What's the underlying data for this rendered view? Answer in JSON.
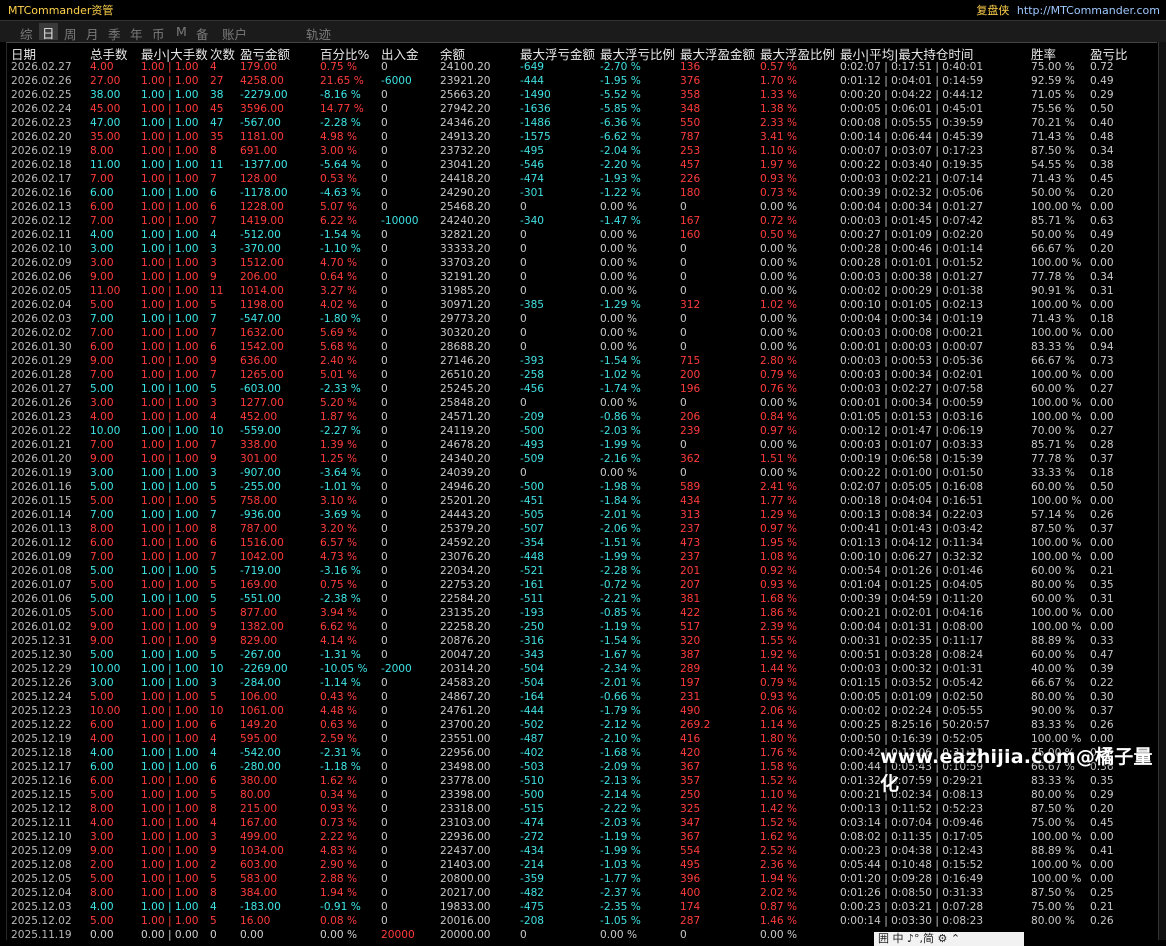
{
  "app": {
    "title": "MTCommander资管",
    "right_cn": "复盘侠",
    "right_url": "http://MTCommander.com"
  },
  "tabs": [
    {
      "label": "综",
      "active": false
    },
    {
      "label": "日",
      "active": true
    },
    {
      "label": "周",
      "active": false
    },
    {
      "label": "月",
      "active": false
    },
    {
      "label": "季",
      "active": false
    },
    {
      "label": "年",
      "active": false
    },
    {
      "label": "币",
      "active": false
    },
    {
      "label": "M",
      "active": false
    },
    {
      "label": "备",
      "active": false
    },
    {
      "label": "账户",
      "active": false
    },
    {
      "label": "轨迹",
      "active": false
    }
  ],
  "headers": [
    "日期",
    "总手数",
    "最小|大手数",
    "次数",
    "盈亏金额",
    "百分比%",
    "出入金",
    "余额",
    "最大浮亏金额",
    "最大浮亏比例",
    "最大浮盈金额",
    "最大浮盈比例",
    "最小|平均|最大持仓时间",
    "胜率",
    "盈亏比"
  ],
  "rows": [
    [
      "2026.02.27",
      "4.00",
      "1.00 | 1.00",
      "4",
      "179.00",
      "0.75 %",
      "0",
      "24100.20",
      "-649",
      "-2.70 %",
      "136",
      "0.57 %",
      "0:02:07 | 0:17:51 | 0:40:01",
      "75.00 %",
      "0.72"
    ],
    [
      "2026.02.26",
      "27.00",
      "1.00 | 1.00",
      "27",
      "4258.00",
      "21.65 %",
      "-6000",
      "23921.20",
      "-444",
      "-1.95 %",
      "376",
      "1.70 %",
      "0:01:12 | 0:04:01 | 0:14:59",
      "92.59 %",
      "0.49"
    ],
    [
      "2026.02.25",
      "38.00",
      "1.00 | 1.00",
      "38",
      "-2279.00",
      "-8.16 %",
      "0",
      "25663.20",
      "-1490",
      "-5.52 %",
      "358",
      "1.33 %",
      "0:00:20 | 0:04:22 | 0:44:12",
      "71.05 %",
      "0.29"
    ],
    [
      "2026.02.24",
      "45.00",
      "1.00 | 1.00",
      "45",
      "3596.00",
      "14.77 %",
      "0",
      "27942.20",
      "-1636",
      "-5.85 %",
      "348",
      "1.38 %",
      "0:00:05 | 0:06:01 | 0:45:01",
      "75.56 %",
      "0.50"
    ],
    [
      "2026.02.23",
      "47.00",
      "1.00 | 1.00",
      "47",
      "-567.00",
      "-2.28 %",
      "0",
      "24346.20",
      "-1486",
      "-6.36 %",
      "550",
      "2.33 %",
      "0:00:08 | 0:05:55 | 0:39:59",
      "70.21 %",
      "0.40"
    ],
    [
      "2026.02.20",
      "35.00",
      "1.00 | 1.00",
      "35",
      "1181.00",
      "4.98 %",
      "0",
      "24913.20",
      "-1575",
      "-6.62 %",
      "787",
      "3.41 %",
      "0:00:14 | 0:06:44 | 0:45:39",
      "71.43 %",
      "0.48"
    ],
    [
      "2026.02.19",
      "8.00",
      "1.00 | 1.00",
      "8",
      "691.00",
      "3.00 %",
      "0",
      "23732.20",
      "-495",
      "-2.04 %",
      "253",
      "1.10 %",
      "0:00:07 | 0:03:07 | 0:17:23",
      "87.50 %",
      "0.34"
    ],
    [
      "2026.02.18",
      "11.00",
      "1.00 | 1.00",
      "11",
      "-1377.00",
      "-5.64 %",
      "0",
      "23041.20",
      "-546",
      "-2.20 %",
      "457",
      "1.97 %",
      "0:00:22 | 0:03:40 | 0:19:35",
      "54.55 %",
      "0.38"
    ],
    [
      "2026.02.17",
      "7.00",
      "1.00 | 1.00",
      "7",
      "128.00",
      "0.53 %",
      "0",
      "24418.20",
      "-474",
      "-1.93 %",
      "226",
      "0.93 %",
      "0:00:03 | 0:02:21 | 0:07:14",
      "71.43 %",
      "0.45"
    ],
    [
      "2026.02.16",
      "6.00",
      "1.00 | 1.00",
      "6",
      "-1178.00",
      "-4.63 %",
      "0",
      "24290.20",
      "-301",
      "-1.22 %",
      "180",
      "0.73 %",
      "0:00:39 | 0:02:32 | 0:05:06",
      "50.00 %",
      "0.20"
    ],
    [
      "2026.02.13",
      "6.00",
      "1.00 | 1.00",
      "6",
      "1228.00",
      "5.07 %",
      "0",
      "25468.20",
      "0",
      "0.00 %",
      "0",
      "0.00 %",
      "0:00:04 | 0:00:34 | 0:01:27",
      "100.00 %",
      "0.00"
    ],
    [
      "2026.02.12",
      "7.00",
      "1.00 | 1.00",
      "7",
      "1419.00",
      "6.22 %",
      "-10000",
      "24240.20",
      "-340",
      "-1.47 %",
      "167",
      "0.72 %",
      "0:00:03 | 0:01:45 | 0:07:42",
      "85.71 %",
      "0.63"
    ],
    [
      "2026.02.11",
      "4.00",
      "1.00 | 1.00",
      "4",
      "-512.00",
      "-1.54 %",
      "0",
      "32821.20",
      "0",
      "0.00 %",
      "160",
      "0.50 %",
      "0:00:27 | 0:01:09 | 0:02:20",
      "50.00 %",
      "0.49"
    ],
    [
      "2026.02.10",
      "3.00",
      "1.00 | 1.00",
      "3",
      "-370.00",
      "-1.10 %",
      "0",
      "33333.20",
      "0",
      "0.00 %",
      "0",
      "0.00 %",
      "0:00:28 | 0:00:46 | 0:01:14",
      "66.67 %",
      "0.20"
    ],
    [
      "2026.02.09",
      "3.00",
      "1.00 | 1.00",
      "3",
      "1512.00",
      "4.70 %",
      "0",
      "33703.20",
      "0",
      "0.00 %",
      "0",
      "0.00 %",
      "0:00:28 | 0:01:01 | 0:01:52",
      "100.00 %",
      "0.00"
    ],
    [
      "2026.02.06",
      "9.00",
      "1.00 | 1.00",
      "9",
      "206.00",
      "0.64 %",
      "0",
      "32191.20",
      "0",
      "0.00 %",
      "0",
      "0.00 %",
      "0:00:03 | 0:00:38 | 0:01:27",
      "77.78 %",
      "0.34"
    ],
    [
      "2026.02.05",
      "11.00",
      "1.00 | 1.00",
      "11",
      "1014.00",
      "3.27 %",
      "0",
      "31985.20",
      "0",
      "0.00 %",
      "0",
      "0.00 %",
      "0:00:02 | 0:00:29 | 0:01:38",
      "90.91 %",
      "0.31"
    ],
    [
      "2026.02.04",
      "5.00",
      "1.00 | 1.00",
      "5",
      "1198.00",
      "4.02 %",
      "0",
      "30971.20",
      "-385",
      "-1.29 %",
      "312",
      "1.02 %",
      "0:00:10 | 0:01:05 | 0:02:13",
      "100.00 %",
      "0.00"
    ],
    [
      "2026.02.03",
      "7.00",
      "1.00 | 1.00",
      "7",
      "-547.00",
      "-1.80 %",
      "0",
      "29773.20",
      "0",
      "0.00 %",
      "0",
      "0.00 %",
      "0:00:04 | 0:00:34 | 0:01:19",
      "71.43 %",
      "0.18"
    ],
    [
      "2026.02.02",
      "7.00",
      "1.00 | 1.00",
      "7",
      "1632.00",
      "5.69 %",
      "0",
      "30320.20",
      "0",
      "0.00 %",
      "0",
      "0.00 %",
      "0:00:03 | 0:00:08 | 0:00:21",
      "100.00 %",
      "0.00"
    ],
    [
      "2026.01.30",
      "6.00",
      "1.00 | 1.00",
      "6",
      "1542.00",
      "5.68 %",
      "0",
      "28688.20",
      "0",
      "0.00 %",
      "0",
      "0.00 %",
      "0:00:01 | 0:00:03 | 0:00:07",
      "83.33 %",
      "0.94"
    ],
    [
      "2026.01.29",
      "9.00",
      "1.00 | 1.00",
      "9",
      "636.00",
      "2.40 %",
      "0",
      "27146.20",
      "-393",
      "-1.54 %",
      "715",
      "2.80 %",
      "0:00:03 | 0:00:53 | 0:05:36",
      "66.67 %",
      "0.73"
    ],
    [
      "2026.01.28",
      "7.00",
      "1.00 | 1.00",
      "7",
      "1265.00",
      "5.01 %",
      "0",
      "26510.20",
      "-258",
      "-1.02 %",
      "200",
      "0.79 %",
      "0:00:03 | 0:00:34 | 0:02:01",
      "100.00 %",
      "0.00"
    ],
    [
      "2026.01.27",
      "5.00",
      "1.00 | 1.00",
      "5",
      "-603.00",
      "-2.33 %",
      "0",
      "25245.20",
      "-456",
      "-1.74 %",
      "196",
      "0.76 %",
      "0:00:03 | 0:02:27 | 0:07:58",
      "60.00 %",
      "0.27"
    ],
    [
      "2026.01.26",
      "3.00",
      "1.00 | 1.00",
      "3",
      "1277.00",
      "5.20 %",
      "0",
      "25848.20",
      "0",
      "0.00 %",
      "0",
      "0.00 %",
      "0:00:01 | 0:00:34 | 0:00:59",
      "100.00 %",
      "0.00"
    ],
    [
      "2026.01.23",
      "4.00",
      "1.00 | 1.00",
      "4",
      "452.00",
      "1.87 %",
      "0",
      "24571.20",
      "-209",
      "-0.86 %",
      "206",
      "0.84 %",
      "0:01:05 | 0:01:53 | 0:03:16",
      "100.00 %",
      "0.00"
    ],
    [
      "2026.01.22",
      "10.00",
      "1.00 | 1.00",
      "10",
      "-559.00",
      "-2.27 %",
      "0",
      "24119.20",
      "-500",
      "-2.03 %",
      "239",
      "0.97 %",
      "0:00:12 | 0:01:47 | 0:06:19",
      "70.00 %",
      "0.27"
    ],
    [
      "2026.01.21",
      "7.00",
      "1.00 | 1.00",
      "7",
      "338.00",
      "1.39 %",
      "0",
      "24678.20",
      "-493",
      "-1.99 %",
      "0",
      "0.00 %",
      "0:00:03 | 0:01:07 | 0:03:33",
      "85.71 %",
      "0.28"
    ],
    [
      "2026.01.20",
      "9.00",
      "1.00 | 1.00",
      "9",
      "301.00",
      "1.25 %",
      "0",
      "24340.20",
      "-509",
      "-2.16 %",
      "362",
      "1.51 %",
      "0:00:19 | 0:06:58 | 0:15:39",
      "77.78 %",
      "0.37"
    ],
    [
      "2026.01.19",
      "3.00",
      "1.00 | 1.00",
      "3",
      "-907.00",
      "-3.64 %",
      "0",
      "24039.20",
      "0",
      "0.00 %",
      "0",
      "0.00 %",
      "0:00:22 | 0:01:00 | 0:01:50",
      "33.33 %",
      "0.18"
    ],
    [
      "2026.01.16",
      "5.00",
      "1.00 | 1.00",
      "5",
      "-255.00",
      "-1.01 %",
      "0",
      "24946.20",
      "-500",
      "-1.98 %",
      "589",
      "2.41 %",
      "0:02:07 | 0:05:05 | 0:16:08",
      "60.00 %",
      "0.50"
    ],
    [
      "2026.01.15",
      "5.00",
      "1.00 | 1.00",
      "5",
      "758.00",
      "3.10 %",
      "0",
      "25201.20",
      "-451",
      "-1.84 %",
      "434",
      "1.77 %",
      "0:00:18 | 0:04:04 | 0:16:51",
      "100.00 %",
      "0.00"
    ],
    [
      "2026.01.14",
      "7.00",
      "1.00 | 1.00",
      "7",
      "-936.00",
      "-3.69 %",
      "0",
      "24443.20",
      "-505",
      "-2.01 %",
      "313",
      "1.29 %",
      "0:00:13 | 0:08:34 | 0:22:03",
      "57.14 %",
      "0.26"
    ],
    [
      "2026.01.13",
      "8.00",
      "1.00 | 1.00",
      "8",
      "787.00",
      "3.20 %",
      "0",
      "25379.20",
      "-507",
      "-2.06 %",
      "237",
      "0.97 %",
      "0:00:41 | 0:01:43 | 0:03:42",
      "87.50 %",
      "0.37"
    ],
    [
      "2026.01.12",
      "6.00",
      "1.00 | 1.00",
      "6",
      "1516.00",
      "6.57 %",
      "0",
      "24592.20",
      "-354",
      "-1.51 %",
      "473",
      "1.95 %",
      "0:01:13 | 0:04:12 | 0:11:34",
      "100.00 %",
      "0.00"
    ],
    [
      "2026.01.09",
      "7.00",
      "1.00 | 1.00",
      "7",
      "1042.00",
      "4.73 %",
      "0",
      "23076.20",
      "-448",
      "-1.99 %",
      "237",
      "1.08 %",
      "0:00:10 | 0:06:27 | 0:32:32",
      "100.00 %",
      "0.00"
    ],
    [
      "2026.01.08",
      "5.00",
      "1.00 | 1.00",
      "5",
      "-719.00",
      "-3.16 %",
      "0",
      "22034.20",
      "-521",
      "-2.28 %",
      "201",
      "0.92 %",
      "0:00:54 | 0:01:26 | 0:01:46",
      "60.00 %",
      "0.21"
    ],
    [
      "2026.01.07",
      "5.00",
      "1.00 | 1.00",
      "5",
      "169.00",
      "0.75 %",
      "0",
      "22753.20",
      "-161",
      "-0.72 %",
      "207",
      "0.93 %",
      "0:01:04 | 0:01:25 | 0:04:05",
      "80.00 %",
      "0.35"
    ],
    [
      "2026.01.06",
      "5.00",
      "1.00 | 1.00",
      "5",
      "-551.00",
      "-2.38 %",
      "0",
      "22584.20",
      "-511",
      "-2.21 %",
      "381",
      "1.68 %",
      "0:00:39 | 0:04:59 | 0:11:20",
      "60.00 %",
      "0.31"
    ],
    [
      "2026.01.05",
      "5.00",
      "1.00 | 1.00",
      "5",
      "877.00",
      "3.94 %",
      "0",
      "23135.20",
      "-193",
      "-0.85 %",
      "422",
      "1.86 %",
      "0:00:21 | 0:02:01 | 0:04:16",
      "100.00 %",
      "0.00"
    ],
    [
      "2026.01.02",
      "9.00",
      "1.00 | 1.00",
      "9",
      "1382.00",
      "6.62 %",
      "0",
      "22258.20",
      "-250",
      "-1.19 %",
      "517",
      "2.39 %",
      "0:00:04 | 0:01:31 | 0:08:00",
      "100.00 %",
      "0.00"
    ],
    [
      "2025.12.31",
      "9.00",
      "1.00 | 1.00",
      "9",
      "829.00",
      "4.14 %",
      "0",
      "20876.20",
      "-316",
      "-1.54 %",
      "320",
      "1.55 %",
      "0:00:31 | 0:02:35 | 0:11:17",
      "88.89 %",
      "0.33"
    ],
    [
      "2025.12.30",
      "5.00",
      "1.00 | 1.00",
      "5",
      "-267.00",
      "-1.31 %",
      "0",
      "20047.20",
      "-343",
      "-1.67 %",
      "387",
      "1.92 %",
      "0:00:51 | 0:03:28 | 0:08:24",
      "60.00 %",
      "0.47"
    ],
    [
      "2025.12.29",
      "10.00",
      "1.00 | 1.00",
      "10",
      "-2269.00",
      "-10.05 %",
      "-2000",
      "20314.20",
      "-504",
      "-2.34 %",
      "289",
      "1.44 %",
      "0:00:03 | 0:00:32 | 0:01:31",
      "40.00 %",
      "0.39"
    ],
    [
      "2025.12.26",
      "3.00",
      "1.00 | 1.00",
      "3",
      "-284.00",
      "-1.14 %",
      "0",
      "24583.20",
      "-504",
      "-2.01 %",
      "197",
      "0.79 %",
      "0:01:15 | 0:03:52 | 0:05:42",
      "66.67 %",
      "0.22"
    ],
    [
      "2025.12.24",
      "5.00",
      "1.00 | 1.00",
      "5",
      "106.00",
      "0.43 %",
      "0",
      "24867.20",
      "-164",
      "-0.66 %",
      "231",
      "0.93 %",
      "0:00:05 | 0:01:09 | 0:02:50",
      "80.00 %",
      "0.30"
    ],
    [
      "2025.12.23",
      "10.00",
      "1.00 | 1.00",
      "10",
      "1061.00",
      "4.48 %",
      "0",
      "24761.20",
      "-444",
      "-1.79 %",
      "490",
      "2.06 %",
      "0:00:02 | 0:02:24 | 0:05:55",
      "90.00 %",
      "0.37"
    ],
    [
      "2025.12.22",
      "6.00",
      "1.00 | 1.00",
      "6",
      "149.20",
      "0.63 %",
      "0",
      "23700.20",
      "-502",
      "-2.12 %",
      "269.2",
      "1.14 %",
      "0:00:25 | 8:25:16 | 50:20:57",
      "83.33 %",
      "0.26"
    ],
    [
      "2025.12.19",
      "4.00",
      "1.00 | 1.00",
      "4",
      "595.00",
      "2.59 %",
      "0",
      "23551.00",
      "-487",
      "-2.10 %",
      "416",
      "1.80 %",
      "0:00:50 | 0:16:39 | 0:52:05",
      "100.00 %",
      "0.00"
    ],
    [
      "2025.12.18",
      "4.00",
      "1.00 | 1.00",
      "4",
      "-542.00",
      "-2.31 %",
      "0",
      "22956.00",
      "-402",
      "-1.68 %",
      "420",
      "1.76 %",
      "0:00:42 | 0:12:06 | 0:31:12",
      "75.00 %",
      "0.22"
    ],
    [
      "2025.12.17",
      "6.00",
      "1.00 | 1.00",
      "6",
      "-280.00",
      "-1.18 %",
      "0",
      "23498.00",
      "-503",
      "-2.09 %",
      "367",
      "1.58 %",
      "0:00:44 | 0:05:43 | 0:10:59",
      "66.67 %",
      "0.36"
    ],
    [
      "2025.12.16",
      "6.00",
      "1.00 | 1.00",
      "6",
      "380.00",
      "1.62 %",
      "0",
      "23778.00",
      "-510",
      "-2.13 %",
      "357",
      "1.52 %",
      "0:01:32 | 0:07:59 | 0:29:21",
      "83.33 %",
      "0.35"
    ],
    [
      "2025.12.15",
      "5.00",
      "1.00 | 1.00",
      "5",
      "80.00",
      "0.34 %",
      "0",
      "23398.00",
      "-500",
      "-2.14 %",
      "250",
      "1.10 %",
      "0:00:21 | 0:02:34 | 0:08:13",
      "80.00 %",
      "0.29"
    ],
    [
      "2025.12.12",
      "8.00",
      "1.00 | 1.00",
      "8",
      "215.00",
      "0.93 %",
      "0",
      "23318.00",
      "-515",
      "-2.22 %",
      "325",
      "1.42 %",
      "0:00:13 | 0:11:52 | 0:52:23",
      "87.50 %",
      "0.20"
    ],
    [
      "2025.12.11",
      "4.00",
      "1.00 | 1.00",
      "4",
      "167.00",
      "0.73 %",
      "0",
      "23103.00",
      "-474",
      "-2.03 %",
      "347",
      "1.52 %",
      "0:03:14 | 0:07:04 | 0:09:46",
      "75.00 %",
      "0.45"
    ],
    [
      "2025.12.10",
      "3.00",
      "1.00 | 1.00",
      "3",
      "499.00",
      "2.22 %",
      "0",
      "22936.00",
      "-272",
      "-1.19 %",
      "367",
      "1.62 %",
      "0:08:02 | 0:11:35 | 0:17:05",
      "100.00 %",
      "0.00"
    ],
    [
      "2025.12.09",
      "9.00",
      "1.00 | 1.00",
      "9",
      "1034.00",
      "4.83 %",
      "0",
      "22437.00",
      "-434",
      "-1.99 %",
      "554",
      "2.52 %",
      "0:00:23 | 0:04:38 | 0:12:43",
      "88.89 %",
      "0.41"
    ],
    [
      "2025.12.08",
      "2.00",
      "1.00 | 1.00",
      "2",
      "603.00",
      "2.90 %",
      "0",
      "21403.00",
      "-214",
      "-1.03 %",
      "495",
      "2.36 %",
      "0:05:44 | 0:10:48 | 0:15:52",
      "100.00 %",
      "0.00"
    ],
    [
      "2025.12.05",
      "5.00",
      "1.00 | 1.00",
      "5",
      "583.00",
      "2.88 %",
      "0",
      "20800.00",
      "-359",
      "-1.77 %",
      "396",
      "1.94 %",
      "0:01:20 | 0:09:28 | 0:16:49",
      "100.00 %",
      "0.00"
    ],
    [
      "2025.12.04",
      "8.00",
      "1.00 | 1.00",
      "8",
      "384.00",
      "1.94 %",
      "0",
      "20217.00",
      "-482",
      "-2.37 %",
      "400",
      "2.02 %",
      "0:01:26 | 0:08:50 | 0:31:33",
      "87.50 %",
      "0.25"
    ],
    [
      "2025.12.03",
      "4.00",
      "1.00 | 1.00",
      "4",
      "-183.00",
      "-0.91 %",
      "0",
      "19833.00",
      "-475",
      "-2.35 %",
      "174",
      "0.87 %",
      "0:00:23 | 0:03:21 | 0:07:28",
      "75.00 %",
      "0.21"
    ],
    [
      "2025.12.02",
      "5.00",
      "1.00 | 1.00",
      "5",
      "16.00",
      "0.08 %",
      "0",
      "20016.00",
      "-208",
      "-1.05 %",
      "287",
      "1.46 %",
      "0:00:14 | 0:03:30 | 0:08:23",
      "80.00 %",
      "0.26"
    ],
    [
      "2025.11.19",
      "0.00",
      "0.00 | 0.00",
      "0",
      "0.00",
      "0.00 %",
      "20000",
      "20000.00",
      "0",
      "0.00 %",
      "0",
      "0.00 %",
      "",
      "",
      ""
    ]
  ],
  "watermark": "www.eazhijia.com@橘子量化",
  "ime_bar": "囲 中 ♪°,简 ⚙ ⌃",
  "colors": {
    "up": "#ff3b3b",
    "down": "#3ee6e6",
    "accent": "#ffd24a",
    "link": "#9ec8ff"
  }
}
